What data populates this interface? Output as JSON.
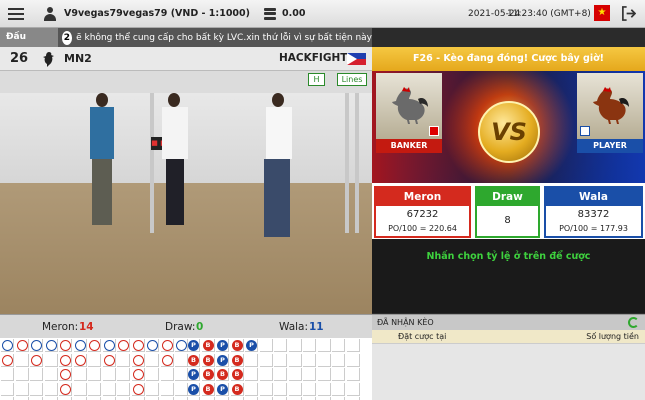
{
  "topbar": {
    "username": "V9vegas79vegas79 (VND - 1:1000)",
    "balance": "0.00",
    "date": "2021-05-24",
    "time": "11:23:40 (GMT+8)"
  },
  "marquee": {
    "label": "Đấu trường",
    "badge": "2",
    "text": "ẽ không thể cung cấp cho bất kỳ LVC.xin thứ lỗi vì sự bất tiện này"
  },
  "match": {
    "number": "26",
    "arena": "MN2",
    "source": "HACKFIGHT"
  },
  "video": {
    "btn_h": "H",
    "btn_lines": "Lines"
  },
  "fight": {
    "status": "F26 - Kèo đang đóng! Cược bây giờ!",
    "banker_label": "BANKER",
    "player_label": "PLAYER",
    "vs": "VS"
  },
  "bets": {
    "meron": {
      "label": "Meron",
      "value": "67232",
      "odds": "PO/100 = 220.64",
      "color": "#d42a1e"
    },
    "draw": {
      "label": "Draw",
      "value": "8",
      "color": "#2ea82e"
    },
    "wala": {
      "label": "Wala",
      "value": "83372",
      "odds": "PO/100 = 177.93",
      "color": "#1a4fa8"
    }
  },
  "instruction": "Nhấn chọn tỷ lệ ở trên để cược",
  "scores": {
    "meron_label": "Meron:",
    "meron_value": "14",
    "draw_label": "Draw:",
    "draw_value": "0",
    "wala_label": "Wala:",
    "wala_value": "11"
  },
  "accepted": {
    "title": "ĐÃ NHẬN KÈO",
    "col_bet": "Đặt cược tại",
    "col_amount": "Số lượng tiền"
  },
  "road": {
    "big_road_rows": [
      [
        "B",
        "R",
        "B",
        "B",
        "R",
        "B",
        "R",
        "B",
        "R",
        "R",
        "B",
        "R",
        "B"
      ],
      [
        "R",
        "",
        "R",
        "",
        "R",
        "R",
        "",
        "R",
        "",
        "R",
        "",
        "R",
        ""
      ],
      [
        "",
        "",
        "",
        "",
        "R",
        "",
        "",
        "",
        "",
        "R",
        "",
        "",
        ""
      ],
      [
        "",
        "",
        "",
        "",
        "R",
        "",
        "",
        "",
        "",
        "R",
        "",
        "",
        ""
      ]
    ],
    "bead_rows": [
      [
        "P",
        "B",
        "P",
        "B",
        "P"
      ],
      [
        "B",
        "B",
        "P",
        "B",
        ""
      ],
      [
        "P",
        "B",
        "B",
        "B",
        ""
      ],
      [
        "P",
        "B",
        "P",
        "B",
        ""
      ]
    ]
  }
}
